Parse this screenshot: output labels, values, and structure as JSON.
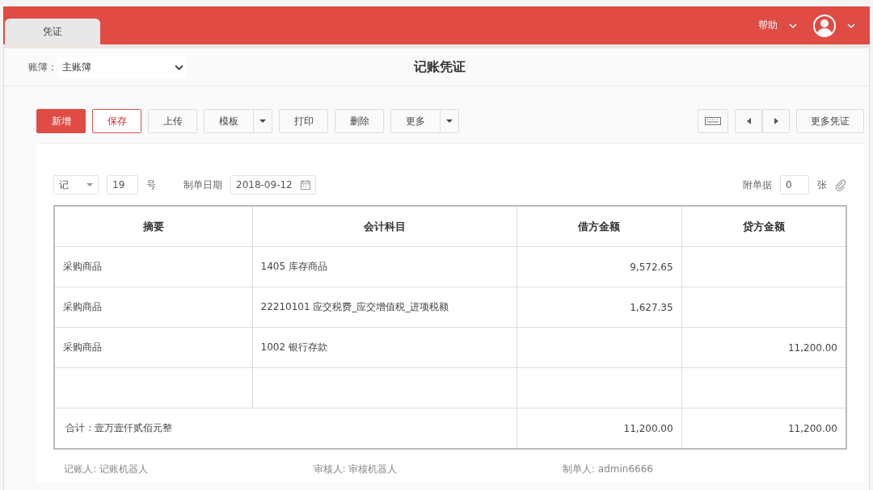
{
  "tabs": [
    {
      "label": "凭证",
      "selected": true
    }
  ],
  "header": {
    "help": "帮助",
    "book_label": "账簿：",
    "book_value": "主账簿",
    "title": "记账凭证"
  },
  "toolbar": [
    {
      "label": "新增",
      "kind": "primary"
    },
    {
      "label": "保存",
      "kind": "outline"
    },
    {
      "label": "上传",
      "kind": "plain"
    },
    {
      "label": "模板",
      "kind": "split"
    },
    {
      "label": "打印",
      "kind": "plain"
    },
    {
      "label": "删除",
      "kind": "plain"
    },
    {
      "label": "更多",
      "kind": "split"
    }
  ],
  "more_vouchers": "更多凭证",
  "voucher": {
    "type": "记",
    "number": "19",
    "number_suffix": "号",
    "date_label": "制单日期",
    "date": "2018-09-12",
    "attach_label": "附单据",
    "attach_count": "0",
    "attach_unit": "张"
  },
  "table": {
    "columns": [
      "摘要",
      "会计科目",
      "借方金额",
      "贷方金额"
    ],
    "rows": [
      [
        "采购商品",
        "1405 库存商品",
        "9,572.65",
        ""
      ],
      [
        "采购商品",
        "22210101 应交税费_应交增值税_进项税额",
        "1,627.35",
        ""
      ],
      [
        "采购商品",
        "1002 银行存款",
        "",
        "11,200.00"
      ],
      [
        "",
        "",
        "",
        ""
      ]
    ],
    "total": {
      "label": "合计：壹万壹仟贰佰元整",
      "debit": "11,200.00",
      "credit": "11,200.00"
    }
  },
  "signers": [
    "记账人: 记账机器人",
    "审核人: 审核机器人",
    "制单人: admin6666"
  ]
}
